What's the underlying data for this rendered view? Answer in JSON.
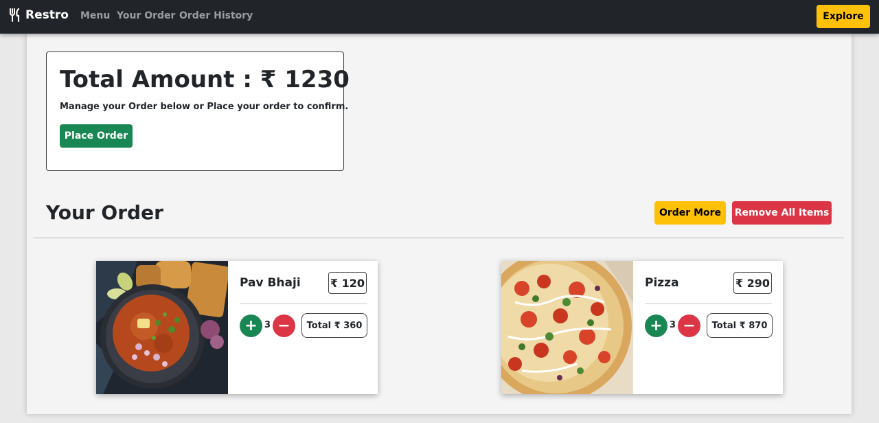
{
  "navbar": {
    "brand": "Restro",
    "links": [
      "Menu",
      "Your Order",
      "Order History"
    ],
    "explore_label": "Explore"
  },
  "summary": {
    "total_label": "Total Amount : ₹ 1230",
    "manage_text": "Manage your Order below or Place your order to confirm.",
    "place_order_label": "Place Order"
  },
  "section": {
    "title": "Your Order",
    "order_more_label": "Order More",
    "remove_all_label": "Remove All Items"
  },
  "items": [
    {
      "name": "Pav Bhaji",
      "price": "₹ 120",
      "qty": "3",
      "total": "Total ₹ 360"
    },
    {
      "name": "Pizza",
      "price": "₹ 290",
      "qty": "3",
      "total": "Total ₹ 870"
    }
  ],
  "colors": {
    "navbar": "#212529",
    "warning": "#ffc107",
    "success": "#198754",
    "danger": "#dc3545"
  }
}
